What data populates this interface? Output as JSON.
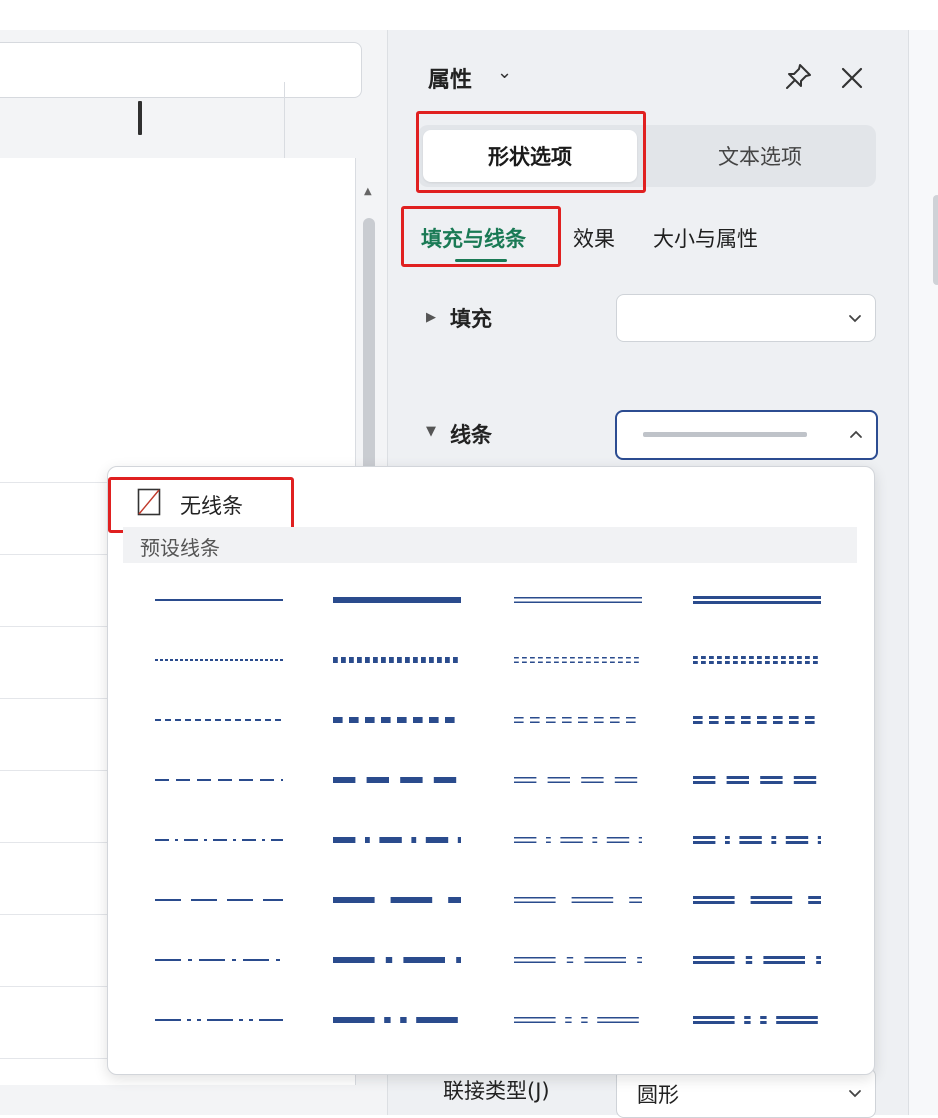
{
  "panel": {
    "title": "属性",
    "tabs": [
      {
        "label": "形状选项",
        "active": true
      },
      {
        "label": "文本选项",
        "active": false
      }
    ],
    "subtabs": [
      {
        "label": "填充与线条",
        "active": true
      },
      {
        "label": "效果",
        "active": false
      },
      {
        "label": "大小与属性",
        "active": false
      }
    ],
    "fill": {
      "label": "填充",
      "expanded": false
    },
    "line": {
      "label": "线条",
      "expanded": true
    },
    "join": {
      "label": "联接类型(J)",
      "value": "圆形"
    }
  },
  "popup": {
    "no_line_label": "无线条",
    "preset_header": "预设线条",
    "columns": [
      "single-thin",
      "single-thick",
      "double-thin",
      "double-thick"
    ],
    "rows": [
      "solid",
      "round-dot",
      "square-dot",
      "dash",
      "dash-dot",
      "long-dash",
      "long-dash-dot",
      "long-dash-dot-dot"
    ]
  },
  "colors": {
    "accent_green": "#1a7a55",
    "line_blue": "#2a4b8d",
    "highlight_red": "#e02020",
    "panel_bg": "#eef0f3"
  }
}
